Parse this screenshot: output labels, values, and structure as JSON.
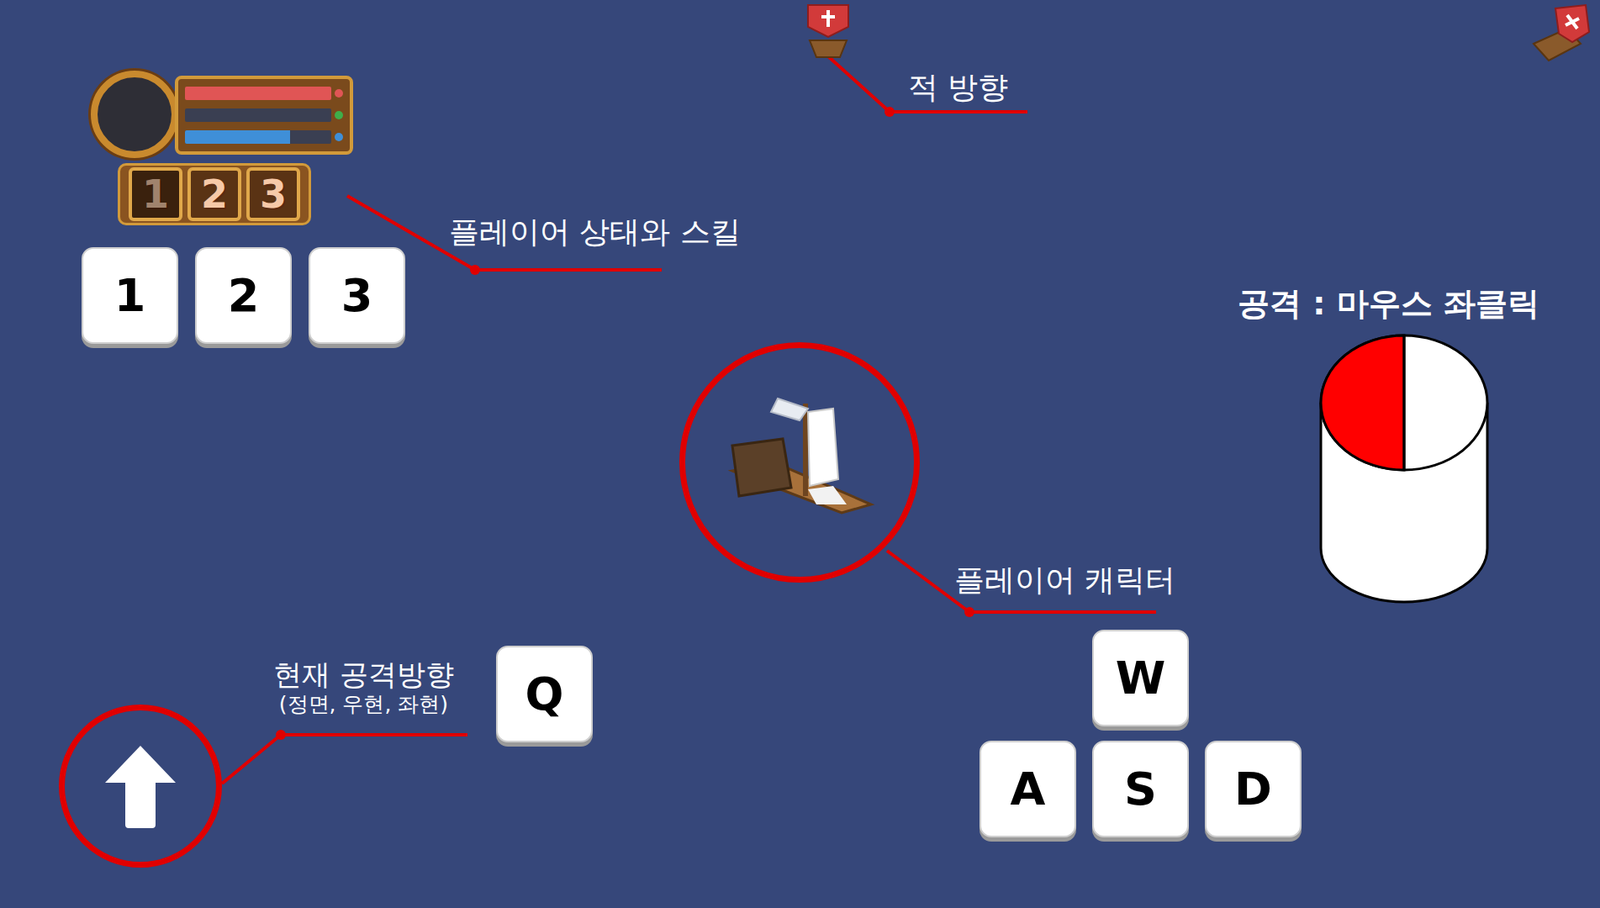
{
  "hud": {
    "bars": [
      {
        "name": "health",
        "level": 1,
        "color": "#e05555"
      },
      {
        "name": "stamina",
        "level": 0,
        "color": "#3fae4a"
      },
      {
        "name": "mana",
        "level": 0.72,
        "color": "#3f8fd8"
      }
    ],
    "skills": [
      {
        "label": "1",
        "cooldown": true
      },
      {
        "label": "2",
        "cooldown": false
      },
      {
        "label": "3",
        "cooldown": false
      }
    ]
  },
  "skill_keys": [
    "1",
    "2",
    "3"
  ],
  "annotations": {
    "enemy_direction": "적 방향",
    "player_status": "플레이어 상태와 스킬",
    "player_character": "플레이어 캐릭터",
    "attack_direction": "현재 공격방향",
    "attack_direction_options": "(정면, 우현, 좌현)"
  },
  "attack_key": "Q",
  "move_keys": [
    "W",
    "A",
    "S",
    "D"
  ],
  "mouse": {
    "label": "공격 : 마우스 좌클릭",
    "left_button_pressed": true
  }
}
